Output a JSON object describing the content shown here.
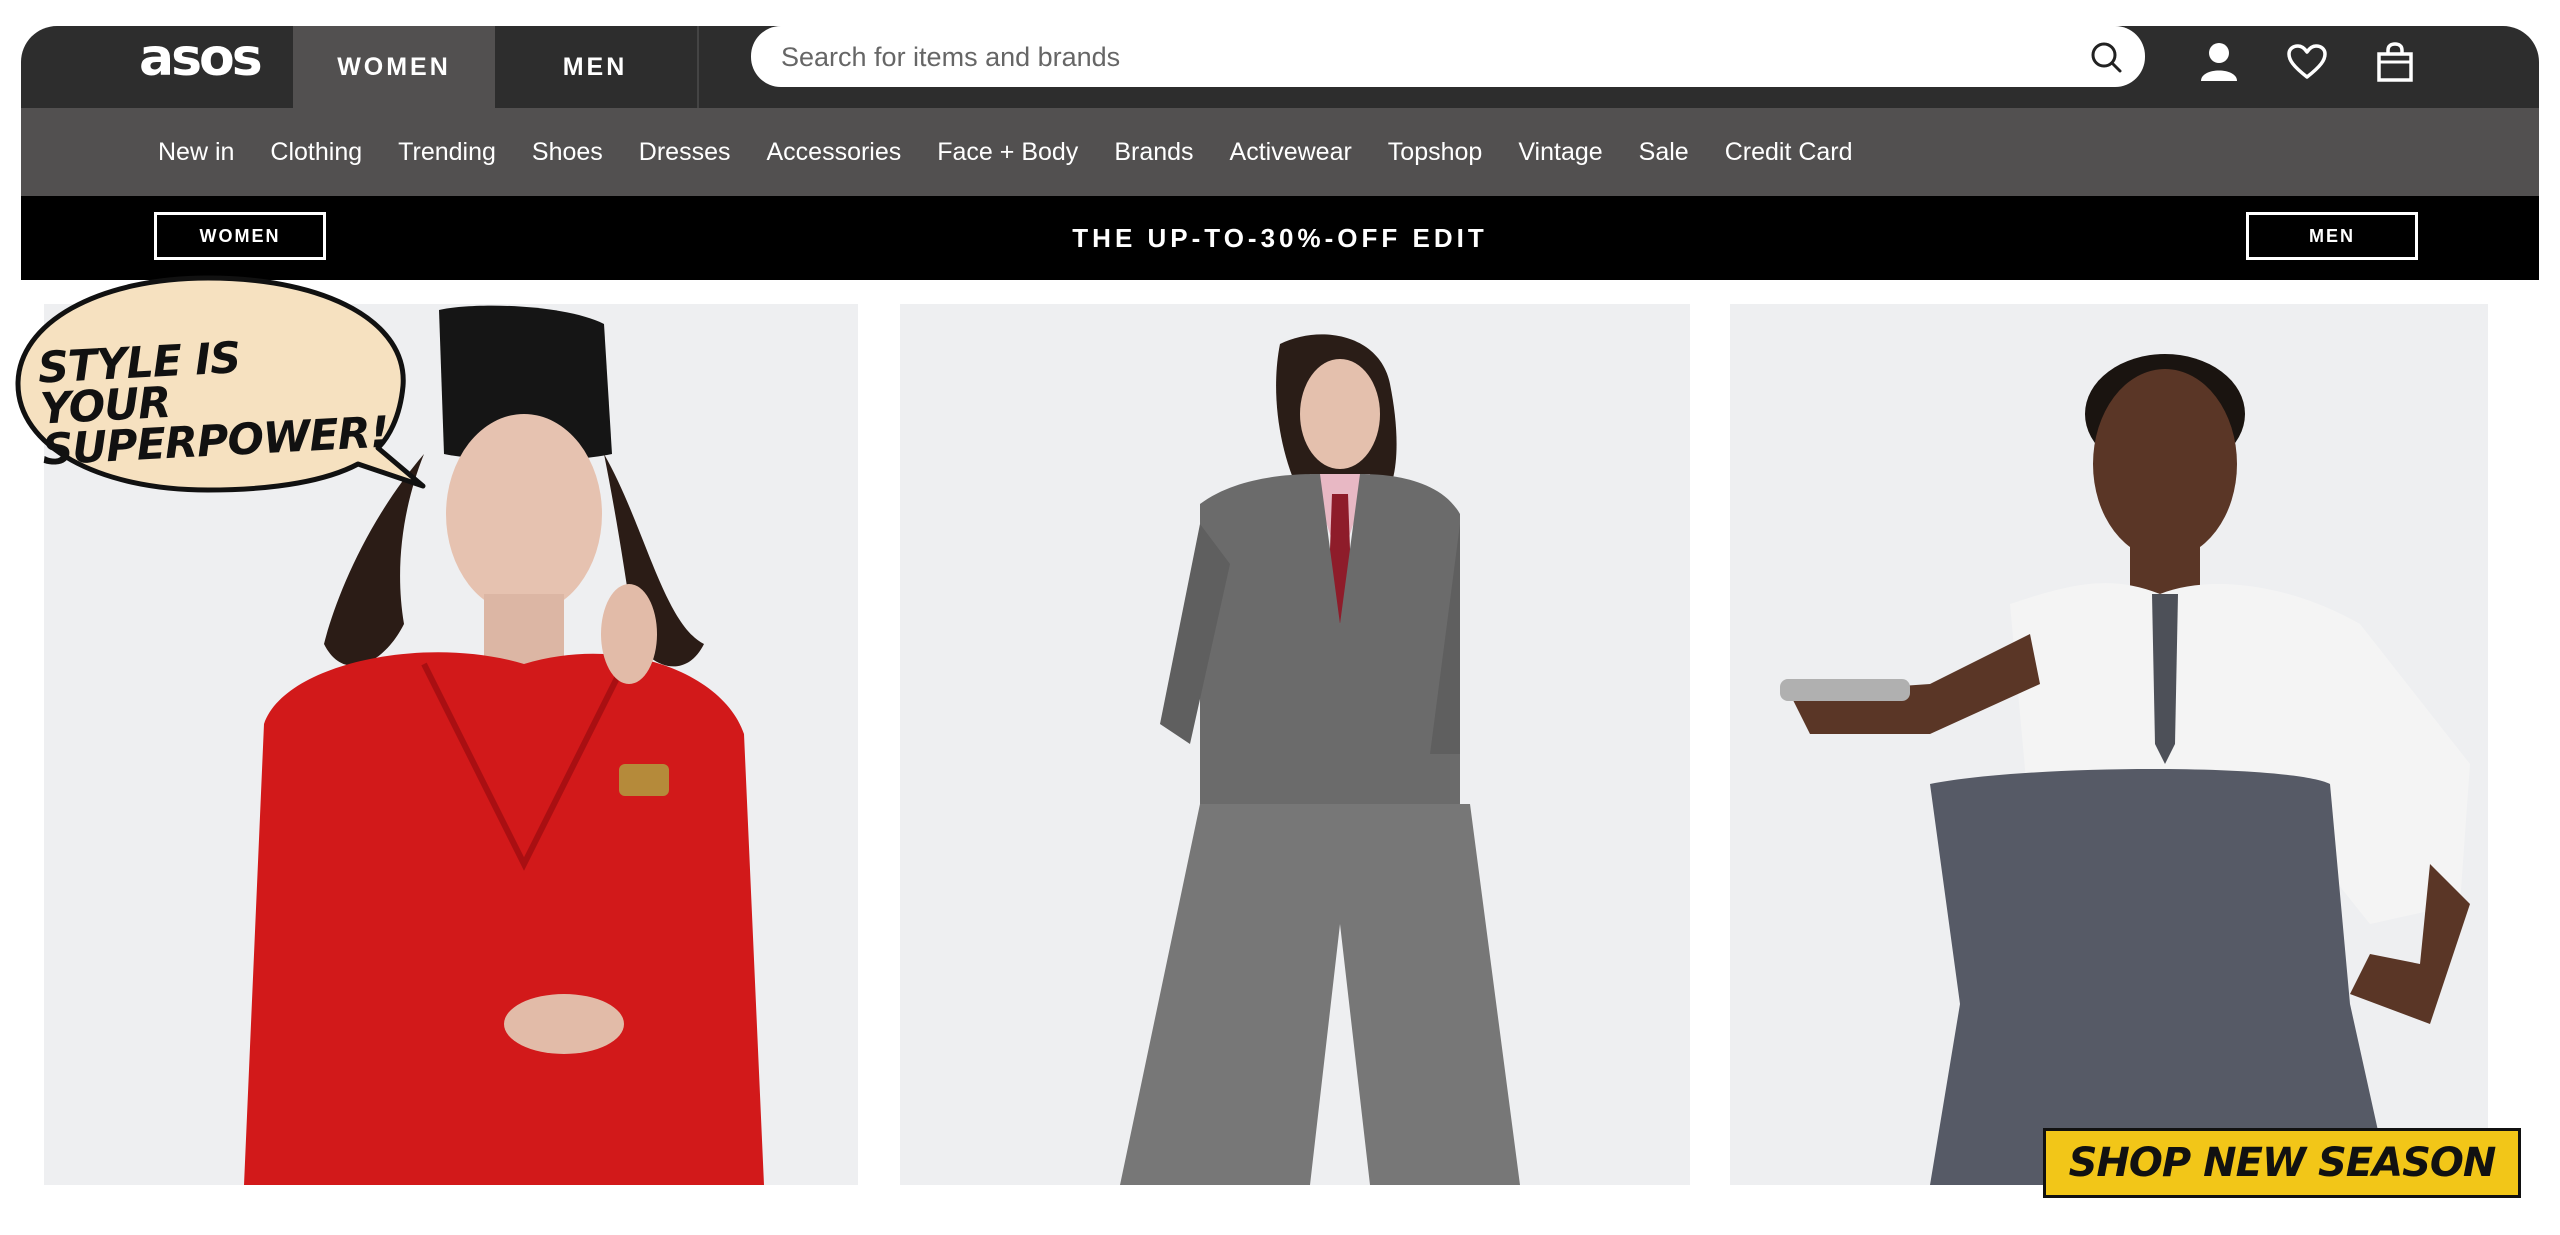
{
  "header": {
    "logo_text": "asos",
    "tabs": [
      {
        "label": "WOMEN",
        "active": true
      },
      {
        "label": "MEN",
        "active": false
      }
    ],
    "search": {
      "placeholder": "Search for items and brands"
    },
    "icons": [
      "search-icon",
      "account-icon",
      "heart-icon",
      "bag-icon"
    ]
  },
  "nav": {
    "items": [
      "New in",
      "Clothing",
      "Trending",
      "Shoes",
      "Dresses",
      "Accessories",
      "Face + Body",
      "Brands",
      "Activewear",
      "Topshop",
      "Vintage",
      "Sale",
      "Credit Card"
    ]
  },
  "promo": {
    "left_button": "WOMEN",
    "title": "THE UP-TO-30%-OFF EDIT",
    "right_button": "MEN"
  },
  "hero": {
    "bubble_text": "STYLE IS YOUR SUPERPOWER!",
    "cta": "SHOP NEW SEASON"
  },
  "colors": {
    "topbar": "#2d2d2d",
    "nav": "#525050",
    "promo": "#000000",
    "cta_yellow": "#f2c618",
    "bubble": "#f6e1c0"
  }
}
